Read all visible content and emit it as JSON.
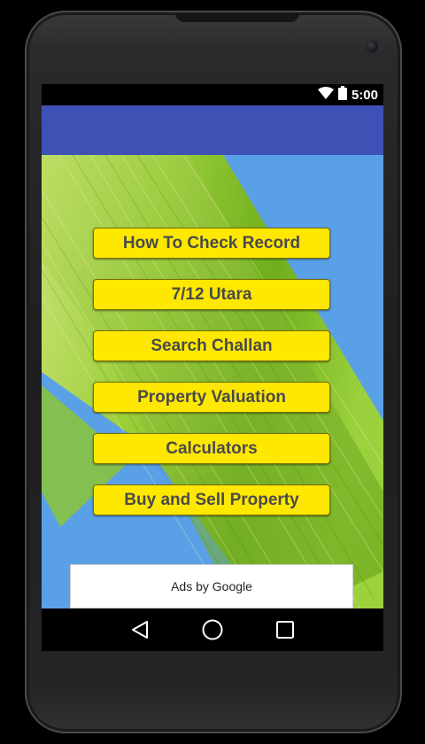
{
  "status_bar": {
    "time": "5:00",
    "icons": [
      "wifi-icon",
      "battery-icon"
    ]
  },
  "menu": {
    "items": [
      {
        "label": "How To Check Record"
      },
      {
        "label": "7/12 Utara"
      },
      {
        "label": "Search Challan"
      },
      {
        "label": "Property Valuation"
      },
      {
        "label": "Calculators"
      },
      {
        "label": "Buy and Sell Property"
      }
    ]
  },
  "ad": {
    "label": "Ads by Google"
  },
  "nav_bar": {
    "icons": [
      "back-icon",
      "home-icon",
      "recents-icon"
    ]
  },
  "colors": {
    "app_bar": "#3f51b5",
    "button_bg": "#ffe800",
    "button_text": "#4a4a4a",
    "sky": "#5aa0e6"
  }
}
